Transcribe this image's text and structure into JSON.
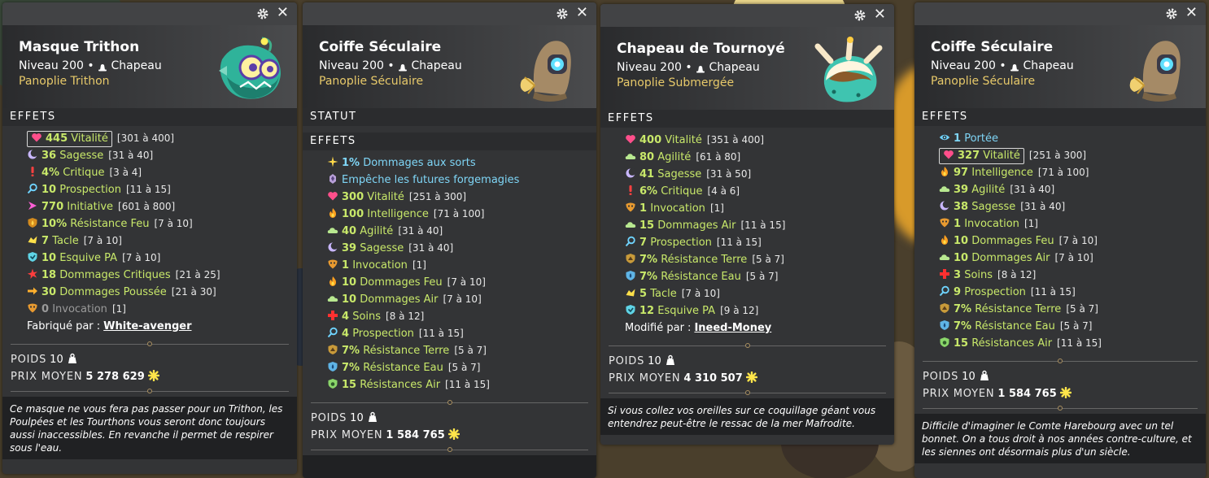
{
  "icons": {
    "settings": "gear-icon",
    "close": "close-icon",
    "hat_type": "hat-icon",
    "weight": "weight-icon",
    "kamas": "kamas-icon"
  },
  "colors": {
    "effect_positive": "#c8e86a",
    "effect_special": "#7fd6f7",
    "effect_disabled": "#9a9a9a",
    "set_name": "#e7c96a"
  },
  "panels": [
    {
      "close_label": "✕",
      "name": "Masque Trithon",
      "level_label": "Niveau 200",
      "bullet": "•",
      "type": "Chapeau",
      "set": "Panoplie Trithon",
      "status_label": "",
      "effects_label": "EFFETS",
      "effects": [
        {
          "icon": "heart-icon",
          "value": "445",
          "label": "Vitalité",
          "range": "[301 à 400]",
          "boxed": true
        },
        {
          "icon": "moon-icon",
          "value": "36",
          "label": "Sagesse",
          "range": "[31 à 40]"
        },
        {
          "icon": "exclamation-icon",
          "value": "4%",
          "label": "Critique",
          "range": "[3 à 4]"
        },
        {
          "icon": "magnifier-icon",
          "value": "10",
          "label": "Prospection",
          "range": "[11 à 15]"
        },
        {
          "icon": "arrow-icon",
          "value": "770",
          "label": "Initiative",
          "range": "[601 à 800]"
        },
        {
          "icon": "fire-shield-icon",
          "value": "10%",
          "label": "Résistance Feu",
          "range": "[7 à 10]"
        },
        {
          "icon": "tackle-icon",
          "value": "7",
          "label": "Tacle",
          "range": "[7 à 10]"
        },
        {
          "icon": "shield-icon",
          "value": "10",
          "label": "Esquive PA",
          "range": "[7 à 10]"
        },
        {
          "icon": "burst-icon",
          "value": "18",
          "label": "Dommages Critiques",
          "range": "[21 à 25]"
        },
        {
          "icon": "push-arrow-icon",
          "value": "30",
          "label": "Dommages Poussée",
          "range": "[21 à 30]"
        },
        {
          "icon": "invocation-icon",
          "value": "0",
          "label": "Invocation",
          "range": "[1]",
          "state": "grey"
        }
      ],
      "maker_label": "Fabriqué par :",
      "maker": "White-avenger",
      "weight_label": "POIDS",
      "weight": "10",
      "price_label": "PRIX MOYEN",
      "price": "5 278 629",
      "description": "Ce masque ne vous fera pas passer pour un Trithon, les Poulpées et les Tourthons vous seront donc toujours aussi inaccessibles. En revanche il permet de respirer sous l'eau."
    },
    {
      "close_label": "✕",
      "name": "Coiffe Séculaire",
      "level_label": "Niveau 200",
      "bullet": "•",
      "type": "Chapeau",
      "set": "Panoplie Séculaire",
      "status_label": "STATUT",
      "effects_label": "EFFETS",
      "effects": [
        {
          "icon": "sparkle-icon",
          "value": "1%",
          "label": "Dommages aux sorts",
          "range": "",
          "state": "blue"
        },
        {
          "icon": "rune-icon",
          "value": "",
          "label": "Empêche les futures forgemagies",
          "range": "",
          "state": "blue"
        },
        {
          "icon": "heart-icon",
          "value": "300",
          "label": "Vitalité",
          "range": "[251 à 300]"
        },
        {
          "icon": "fire-icon",
          "value": "100",
          "label": "Intelligence",
          "range": "[71 à 100]"
        },
        {
          "icon": "cloud-icon",
          "value": "40",
          "label": "Agilité",
          "range": "[31 à 40]"
        },
        {
          "icon": "moon-icon",
          "value": "39",
          "label": "Sagesse",
          "range": "[31 à 40]"
        },
        {
          "icon": "invocation-icon",
          "value": "1",
          "label": "Invocation",
          "range": "[1]"
        },
        {
          "icon": "fire-icon",
          "value": "10",
          "label": "Dommages Feu",
          "range": "[7 à 10]"
        },
        {
          "icon": "cloud-icon",
          "value": "10",
          "label": "Dommages Air",
          "range": "[7 à 10]"
        },
        {
          "icon": "cross-icon",
          "value": "4",
          "label": "Soins",
          "range": "[8 à 12]"
        },
        {
          "icon": "magnifier-icon",
          "value": "4",
          "label": "Prospection",
          "range": "[11 à 15]"
        },
        {
          "icon": "earth-shield-icon",
          "value": "7%",
          "label": "Résistance Terre",
          "range": "[5 à 7]"
        },
        {
          "icon": "water-shield-icon",
          "value": "7%",
          "label": "Résistance Eau",
          "range": "[5 à 7]"
        },
        {
          "icon": "air-shield-icon",
          "value": "15",
          "label": "Résistances Air",
          "range": "[11 à 15]"
        }
      ],
      "maker_label": "",
      "maker": "",
      "weight_label": "POIDS",
      "weight": "10",
      "price_label": "PRIX MOYEN",
      "price": "1 584 765",
      "description": ""
    },
    {
      "close_label": "✕",
      "name": "Chapeau de Tournoyé",
      "level_label": "Niveau 200",
      "bullet": "•",
      "type": "Chapeau",
      "set": "Panoplie Submergée",
      "status_label": "",
      "effects_label": "EFFETS",
      "effects": [
        {
          "icon": "heart-icon",
          "value": "400",
          "label": "Vitalité",
          "range": "[351 à 400]"
        },
        {
          "icon": "cloud-icon",
          "value": "80",
          "label": "Agilité",
          "range": "[61 à 80]"
        },
        {
          "icon": "moon-icon",
          "value": "41",
          "label": "Sagesse",
          "range": "[31 à 50]"
        },
        {
          "icon": "exclamation-icon",
          "value": "6%",
          "label": "Critique",
          "range": "[4 à 6]"
        },
        {
          "icon": "invocation-icon",
          "value": "1",
          "label": "Invocation",
          "range": "[1]"
        },
        {
          "icon": "cloud-icon",
          "value": "15",
          "label": "Dommages Air",
          "range": "[11 à 15]"
        },
        {
          "icon": "magnifier-icon",
          "value": "7",
          "label": "Prospection",
          "range": "[11 à 15]"
        },
        {
          "icon": "earth-shield-icon",
          "value": "7%",
          "label": "Résistance Terre",
          "range": "[5 à 7]"
        },
        {
          "icon": "water-shield-icon",
          "value": "7%",
          "label": "Résistance Eau",
          "range": "[5 à 7]"
        },
        {
          "icon": "tackle-icon",
          "value": "5",
          "label": "Tacle",
          "range": "[7 à 10]"
        },
        {
          "icon": "shield-icon",
          "value": "12",
          "label": "Esquive PA",
          "range": "[9 à 12]"
        }
      ],
      "maker_label": "Modifié par :",
      "maker": "Ineed-Money",
      "weight_label": "POIDS",
      "weight": "10",
      "price_label": "PRIX MOYEN",
      "price": "4 310 507",
      "description": "Si vous collez vos oreilles sur ce coquillage géant vous entendrez peut-être le ressac de la mer Mafrodite."
    },
    {
      "close_label": "✕",
      "name": "Coiffe Séculaire",
      "level_label": "Niveau 200",
      "bullet": "•",
      "type": "Chapeau",
      "set": "Panoplie Séculaire",
      "status_label": "",
      "effects_label": "EFFETS",
      "effects": [
        {
          "icon": "eye-icon",
          "value": "1",
          "label": "Portée",
          "range": "",
          "state": "blue"
        },
        {
          "icon": "heart-icon",
          "value": "327",
          "label": "Vitalité",
          "range": "[251 à 300]",
          "boxed": true
        },
        {
          "icon": "fire-icon",
          "value": "97",
          "label": "Intelligence",
          "range": "[71 à 100]"
        },
        {
          "icon": "cloud-icon",
          "value": "39",
          "label": "Agilité",
          "range": "[31 à 40]"
        },
        {
          "icon": "moon-icon",
          "value": "38",
          "label": "Sagesse",
          "range": "[31 à 40]"
        },
        {
          "icon": "invocation-icon",
          "value": "1",
          "label": "Invocation",
          "range": "[1]"
        },
        {
          "icon": "fire-icon",
          "value": "10",
          "label": "Dommages Feu",
          "range": "[7 à 10]"
        },
        {
          "icon": "cloud-icon",
          "value": "10",
          "label": "Dommages Air",
          "range": "[7 à 10]"
        },
        {
          "icon": "cross-icon",
          "value": "3",
          "label": "Soins",
          "range": "[8 à 12]"
        },
        {
          "icon": "magnifier-icon",
          "value": "9",
          "label": "Prospection",
          "range": "[11 à 15]"
        },
        {
          "icon": "earth-shield-icon",
          "value": "7%",
          "label": "Résistance Terre",
          "range": "[5 à 7]"
        },
        {
          "icon": "water-shield-icon",
          "value": "7%",
          "label": "Résistance Eau",
          "range": "[5 à 7]"
        },
        {
          "icon": "air-shield-icon",
          "value": "15",
          "label": "Résistances Air",
          "range": "[11 à 15]"
        }
      ],
      "maker_label": "",
      "maker": "",
      "weight_label": "POIDS",
      "weight": "10",
      "price_label": "PRIX MOYEN",
      "price": "1 584 765",
      "description": "Difficile d'imaginer le Comte Harebourg avec un tel bonnet. On a tous droit à nos années contre-culture, et les siennes ont désormais plus d'un siècle."
    }
  ]
}
